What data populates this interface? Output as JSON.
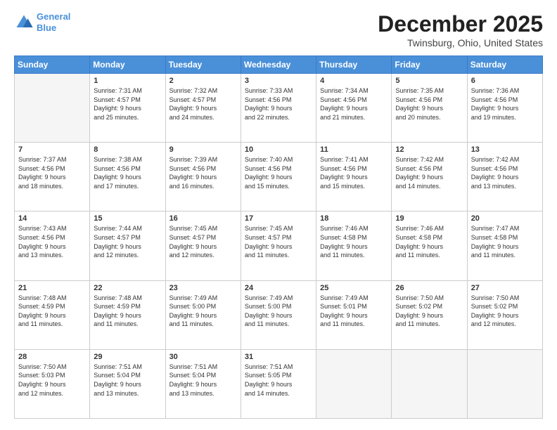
{
  "header": {
    "logo_line1": "General",
    "logo_line2": "Blue",
    "month": "December 2025",
    "location": "Twinsburg, Ohio, United States"
  },
  "days_of_week": [
    "Sunday",
    "Monday",
    "Tuesday",
    "Wednesday",
    "Thursday",
    "Friday",
    "Saturday"
  ],
  "weeks": [
    [
      {
        "day": "",
        "info": ""
      },
      {
        "day": "1",
        "info": "Sunrise: 7:31 AM\nSunset: 4:57 PM\nDaylight: 9 hours\nand 25 minutes."
      },
      {
        "day": "2",
        "info": "Sunrise: 7:32 AM\nSunset: 4:57 PM\nDaylight: 9 hours\nand 24 minutes."
      },
      {
        "day": "3",
        "info": "Sunrise: 7:33 AM\nSunset: 4:56 PM\nDaylight: 9 hours\nand 22 minutes."
      },
      {
        "day": "4",
        "info": "Sunrise: 7:34 AM\nSunset: 4:56 PM\nDaylight: 9 hours\nand 21 minutes."
      },
      {
        "day": "5",
        "info": "Sunrise: 7:35 AM\nSunset: 4:56 PM\nDaylight: 9 hours\nand 20 minutes."
      },
      {
        "day": "6",
        "info": "Sunrise: 7:36 AM\nSunset: 4:56 PM\nDaylight: 9 hours\nand 19 minutes."
      }
    ],
    [
      {
        "day": "7",
        "info": "Sunrise: 7:37 AM\nSunset: 4:56 PM\nDaylight: 9 hours\nand 18 minutes."
      },
      {
        "day": "8",
        "info": "Sunrise: 7:38 AM\nSunset: 4:56 PM\nDaylight: 9 hours\nand 17 minutes."
      },
      {
        "day": "9",
        "info": "Sunrise: 7:39 AM\nSunset: 4:56 PM\nDaylight: 9 hours\nand 16 minutes."
      },
      {
        "day": "10",
        "info": "Sunrise: 7:40 AM\nSunset: 4:56 PM\nDaylight: 9 hours\nand 15 minutes."
      },
      {
        "day": "11",
        "info": "Sunrise: 7:41 AM\nSunset: 4:56 PM\nDaylight: 9 hours\nand 15 minutes."
      },
      {
        "day": "12",
        "info": "Sunrise: 7:42 AM\nSunset: 4:56 PM\nDaylight: 9 hours\nand 14 minutes."
      },
      {
        "day": "13",
        "info": "Sunrise: 7:42 AM\nSunset: 4:56 PM\nDaylight: 9 hours\nand 13 minutes."
      }
    ],
    [
      {
        "day": "14",
        "info": "Sunrise: 7:43 AM\nSunset: 4:56 PM\nDaylight: 9 hours\nand 13 minutes."
      },
      {
        "day": "15",
        "info": "Sunrise: 7:44 AM\nSunset: 4:57 PM\nDaylight: 9 hours\nand 12 minutes."
      },
      {
        "day": "16",
        "info": "Sunrise: 7:45 AM\nSunset: 4:57 PM\nDaylight: 9 hours\nand 12 minutes."
      },
      {
        "day": "17",
        "info": "Sunrise: 7:45 AM\nSunset: 4:57 PM\nDaylight: 9 hours\nand 11 minutes."
      },
      {
        "day": "18",
        "info": "Sunrise: 7:46 AM\nSunset: 4:58 PM\nDaylight: 9 hours\nand 11 minutes."
      },
      {
        "day": "19",
        "info": "Sunrise: 7:46 AM\nSunset: 4:58 PM\nDaylight: 9 hours\nand 11 minutes."
      },
      {
        "day": "20",
        "info": "Sunrise: 7:47 AM\nSunset: 4:58 PM\nDaylight: 9 hours\nand 11 minutes."
      }
    ],
    [
      {
        "day": "21",
        "info": "Sunrise: 7:48 AM\nSunset: 4:59 PM\nDaylight: 9 hours\nand 11 minutes."
      },
      {
        "day": "22",
        "info": "Sunrise: 7:48 AM\nSunset: 4:59 PM\nDaylight: 9 hours\nand 11 minutes."
      },
      {
        "day": "23",
        "info": "Sunrise: 7:49 AM\nSunset: 5:00 PM\nDaylight: 9 hours\nand 11 minutes."
      },
      {
        "day": "24",
        "info": "Sunrise: 7:49 AM\nSunset: 5:00 PM\nDaylight: 9 hours\nand 11 minutes."
      },
      {
        "day": "25",
        "info": "Sunrise: 7:49 AM\nSunset: 5:01 PM\nDaylight: 9 hours\nand 11 minutes."
      },
      {
        "day": "26",
        "info": "Sunrise: 7:50 AM\nSunset: 5:02 PM\nDaylight: 9 hours\nand 11 minutes."
      },
      {
        "day": "27",
        "info": "Sunrise: 7:50 AM\nSunset: 5:02 PM\nDaylight: 9 hours\nand 12 minutes."
      }
    ],
    [
      {
        "day": "28",
        "info": "Sunrise: 7:50 AM\nSunset: 5:03 PM\nDaylight: 9 hours\nand 12 minutes."
      },
      {
        "day": "29",
        "info": "Sunrise: 7:51 AM\nSunset: 5:04 PM\nDaylight: 9 hours\nand 13 minutes."
      },
      {
        "day": "30",
        "info": "Sunrise: 7:51 AM\nSunset: 5:04 PM\nDaylight: 9 hours\nand 13 minutes."
      },
      {
        "day": "31",
        "info": "Sunrise: 7:51 AM\nSunset: 5:05 PM\nDaylight: 9 hours\nand 14 minutes."
      },
      {
        "day": "",
        "info": ""
      },
      {
        "day": "",
        "info": ""
      },
      {
        "day": "",
        "info": ""
      }
    ]
  ]
}
